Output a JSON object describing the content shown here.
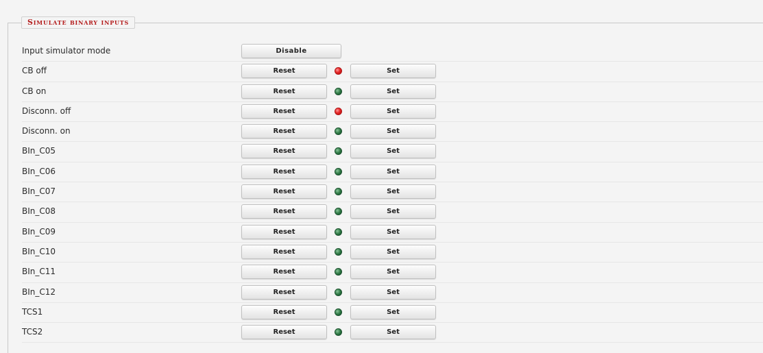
{
  "section": {
    "title": "Simulate binary inputs"
  },
  "mode_row": {
    "label": "Input simulator mode",
    "button_label": "Disable"
  },
  "buttons": {
    "reset_label": "Reset",
    "set_label": "Set"
  },
  "inputs": [
    {
      "label": "CB off",
      "state": "on",
      "led_color": "#e52727"
    },
    {
      "label": "CB on",
      "state": "off",
      "led_color": "#2f7a45"
    },
    {
      "label": "Disconn. off",
      "state": "on",
      "led_color": "#e52727"
    },
    {
      "label": "Disconn. on",
      "state": "off",
      "led_color": "#2f7a45"
    },
    {
      "label": "BIn_C05",
      "state": "off",
      "led_color": "#2f7a45"
    },
    {
      "label": "BIn_C06",
      "state": "off",
      "led_color": "#2f7a45"
    },
    {
      "label": "BIn_C07",
      "state": "off",
      "led_color": "#2f7a45"
    },
    {
      "label": "BIn_C08",
      "state": "off",
      "led_color": "#2f7a45"
    },
    {
      "label": "BIn_C09",
      "state": "off",
      "led_color": "#2f7a45"
    },
    {
      "label": "BIn_C10",
      "state": "off",
      "led_color": "#2f7a45"
    },
    {
      "label": "BIn_C11",
      "state": "off",
      "led_color": "#2f7a45"
    },
    {
      "label": "BIn_C12",
      "state": "off",
      "led_color": "#2f7a45"
    },
    {
      "label": "TCS1",
      "state": "off",
      "led_color": "#2f7a45"
    },
    {
      "label": "TCS2",
      "state": "off",
      "led_color": "#2f7a45"
    }
  ]
}
